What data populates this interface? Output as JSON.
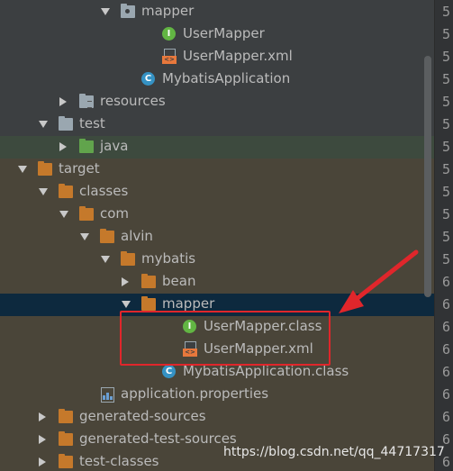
{
  "tree": {
    "rows": [
      {
        "label": "mapper",
        "indent": 4,
        "arrow": "down",
        "icon": "package-folder-icon",
        "style": ""
      },
      {
        "label": "UserMapper",
        "indent": 6,
        "arrow": "none",
        "icon": "interface-icon",
        "style": ""
      },
      {
        "label": "UserMapper.xml",
        "indent": 6,
        "arrow": "none",
        "icon": "xml-file-icon",
        "style": ""
      },
      {
        "label": "MybatisApplication",
        "indent": 5,
        "arrow": "none",
        "icon": "spring-boot-class-icon",
        "style": ""
      },
      {
        "label": "resources",
        "indent": 2,
        "arrow": "right",
        "icon": "resources-folder-icon",
        "style": ""
      },
      {
        "label": "test",
        "indent": 1,
        "arrow": "down",
        "icon": "grey-folder-icon",
        "style": ""
      },
      {
        "label": "java",
        "indent": 2,
        "arrow": "right",
        "icon": "green-folder-icon",
        "style": "bg-test"
      },
      {
        "label": "target",
        "indent": 0,
        "arrow": "down",
        "icon": "orange-folder-icon",
        "style": "bg-target"
      },
      {
        "label": "classes",
        "indent": 1,
        "arrow": "down",
        "icon": "orange-folder-icon",
        "style": "bg-target"
      },
      {
        "label": "com",
        "indent": 2,
        "arrow": "down",
        "icon": "orange-folder-icon",
        "style": "bg-target"
      },
      {
        "label": "alvin",
        "indent": 3,
        "arrow": "down",
        "icon": "orange-folder-icon",
        "style": "bg-target"
      },
      {
        "label": "mybatis",
        "indent": 4,
        "arrow": "down",
        "icon": "orange-folder-icon",
        "style": "bg-target"
      },
      {
        "label": "bean",
        "indent": 5,
        "arrow": "right",
        "icon": "orange-folder-icon",
        "style": "bg-target"
      },
      {
        "label": "mapper",
        "indent": 5,
        "arrow": "down",
        "icon": "orange-folder-icon",
        "style": "bg-sel"
      },
      {
        "label": "UserMapper.class",
        "indent": 7,
        "arrow": "none",
        "icon": "interface-icon",
        "style": "bg-target"
      },
      {
        "label": "UserMapper.xml",
        "indent": 7,
        "arrow": "none",
        "icon": "xml-file-icon",
        "style": "bg-target"
      },
      {
        "label": "MybatisApplication.class",
        "indent": 6,
        "arrow": "none",
        "icon": "class-icon",
        "style": "bg-target"
      },
      {
        "label": "application.properties",
        "indent": 3,
        "arrow": "none",
        "icon": "properties-file-icon",
        "style": "bg-target"
      },
      {
        "label": "generated-sources",
        "indent": 1,
        "arrow": "right",
        "icon": "orange-folder-icon",
        "style": "bg-target"
      },
      {
        "label": "generated-test-sources",
        "indent": 1,
        "arrow": "right",
        "icon": "orange-folder-icon",
        "style": "bg-target"
      },
      {
        "label": "test-classes",
        "indent": 1,
        "arrow": "right",
        "icon": "orange-folder-icon",
        "style": "bg-target"
      }
    ]
  },
  "gutter": {
    "line_digits": [
      "5",
      "5",
      "5",
      "5",
      "5",
      "5",
      "5",
      "5",
      "5",
      "5",
      "5",
      "5",
      "6",
      "6",
      "6",
      "6",
      "6",
      "6",
      "6",
      "6",
      "6"
    ]
  },
  "annotation": {
    "box_color": "#e0262b",
    "arrow_color": "#e0262b"
  },
  "watermark": "https://blog.csdn.net/qq_44717317"
}
